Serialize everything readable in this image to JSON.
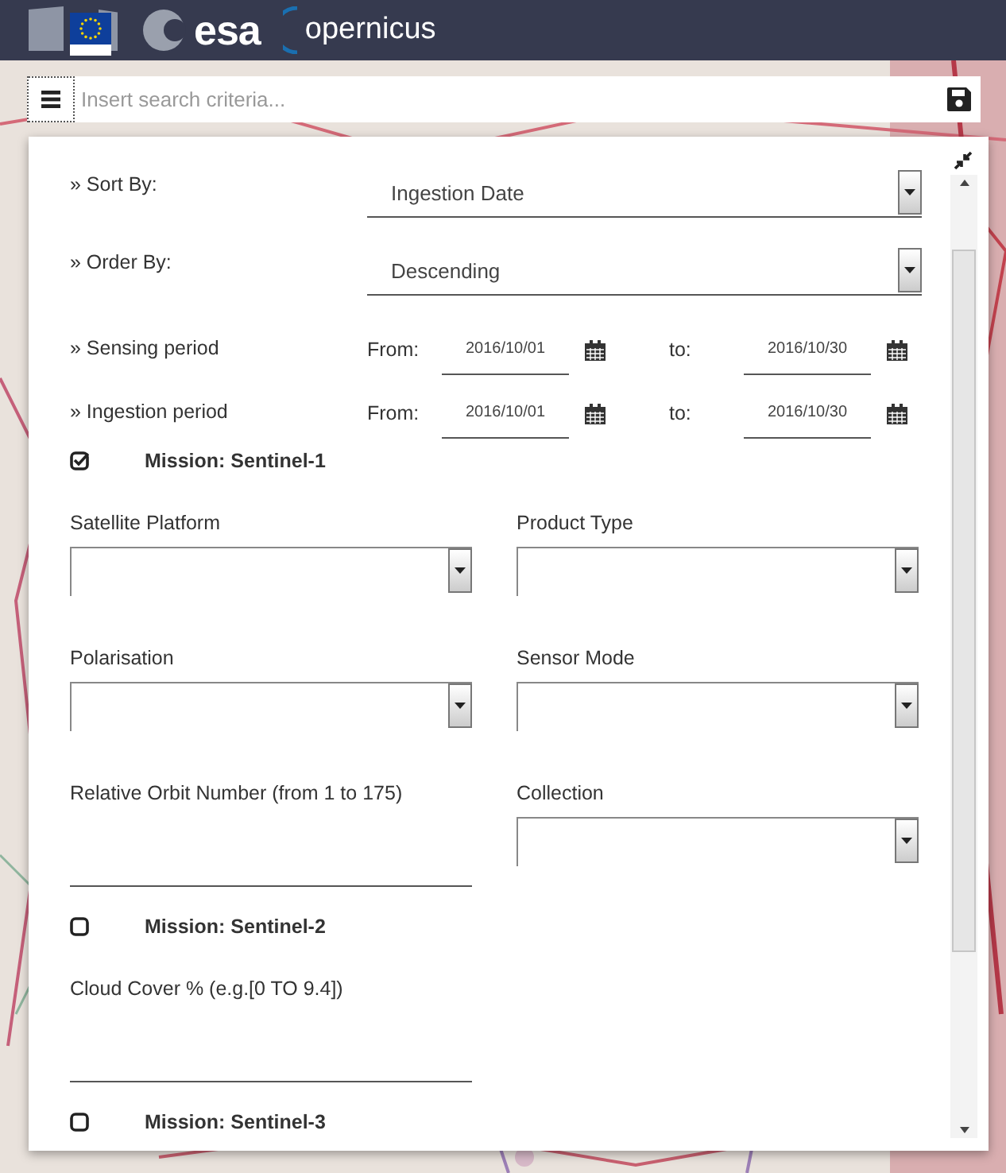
{
  "header": {
    "logo_texts": [
      "esa",
      "opernicus"
    ]
  },
  "search": {
    "placeholder": "Insert search criteria..."
  },
  "sort_by": {
    "label": "» Sort By:",
    "value": "Ingestion Date"
  },
  "order_by": {
    "label": "» Order By:",
    "value": "Descending"
  },
  "periods": [
    {
      "label": "» Sensing period",
      "from_label": "From:",
      "from": "2016/10/01",
      "to_label": "to:",
      "to": "2016/10/30"
    },
    {
      "label": "» Ingestion period",
      "from_label": "From:",
      "from": "2016/10/01",
      "to_label": "to:",
      "to": "2016/10/30"
    }
  ],
  "missions": [
    {
      "title": "Mission: Sentinel-1",
      "checked": true,
      "fields": [
        {
          "label": "Satellite Platform",
          "kind": "select"
        },
        {
          "label": "Product Type",
          "kind": "select"
        },
        {
          "label": "Polarisation",
          "kind": "select"
        },
        {
          "label": "Sensor Mode",
          "kind": "select"
        },
        {
          "label": "Relative Orbit Number (from 1 to 175)",
          "kind": "text"
        },
        {
          "label": "Collection",
          "kind": "select"
        }
      ]
    },
    {
      "title": "Mission: Sentinel-2",
      "checked": false,
      "fields": [
        {
          "label": "Cloud Cover % (e.g.[0 TO 9.4])",
          "kind": "text"
        }
      ]
    },
    {
      "title": "Mission: Sentinel-3",
      "checked": false
    }
  ]
}
